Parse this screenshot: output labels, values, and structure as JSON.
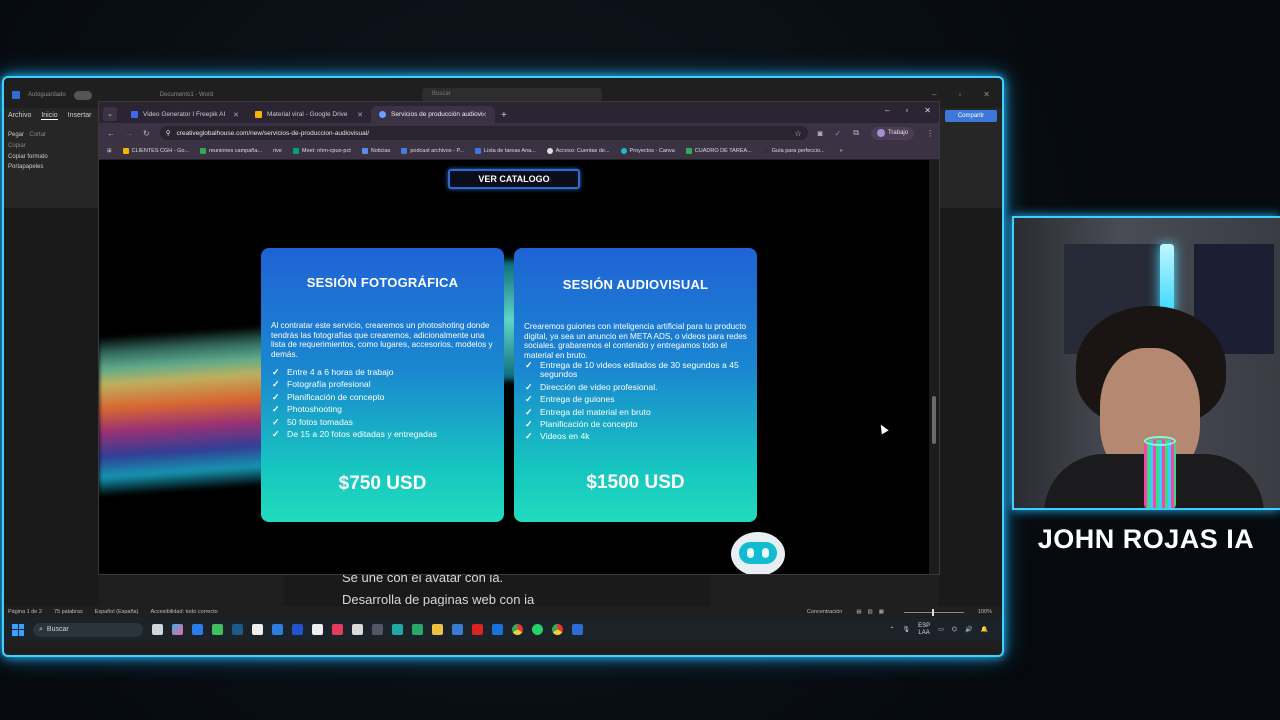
{
  "word": {
    "autosave_label": "Autoguardado",
    "doc_title": "Documento1 - Word",
    "search_placeholder": "Buscar",
    "tabs": [
      "Archivo",
      "Inicio",
      "Insertar"
    ],
    "clipboard": {
      "paste": "Pegar",
      "cut": "Cortar",
      "copy": "Copiar",
      "format_painter": "Copiar formato",
      "group": "Portapapeles"
    },
    "share_label": "Compartir",
    "doc_lines": [
      "Se une con el avatar con ia.",
      "Desarrolla de paginas web con ia"
    ],
    "status": {
      "page": "Página 1 de 2",
      "words": "75 palabras",
      "language": "Español (España)",
      "accessibility": "Accesibilidad: todo correcto",
      "focus": "Concentración",
      "zoom": "100%"
    }
  },
  "browser": {
    "tabs": [
      {
        "label": "Video Generator I Freepik AI",
        "fav": "#3b6cf0"
      },
      {
        "label": "Material viral - Google Drive",
        "fav": "#f2b400"
      },
      {
        "label": "Servicios de producción audiovi",
        "fav": "#6aa0ff"
      }
    ],
    "url": "creativeglobalhouse.com/new/servicios-de-produccion-audiovisual/",
    "profile": "Trabajo",
    "bookmarks": [
      {
        "label": "CLIENTES CGH - Go...",
        "color": "#f2b400"
      },
      {
        "label": "reuniones campaña...",
        "color": "#2faa55"
      },
      {
        "label": "rive",
        "color": "#222222"
      },
      {
        "label": "Meet: nhm-cpuo-pct",
        "color": "#00a37a"
      },
      {
        "label": "Noticias",
        "color": "#5a8cf0"
      },
      {
        "label": "podcast archivos - P...",
        "color": "#4a7ae0"
      },
      {
        "label": "Lista de tareas Ana...",
        "color": "#3a78e0"
      },
      {
        "label": "Acceso: Cuentas de...",
        "color": "#dddddd"
      },
      {
        "label": "Proyectos - Canva",
        "color": "#20b8d0"
      },
      {
        "label": "CUADRO DE TAREA...",
        "color": "#2faa55"
      },
      {
        "label": "Guía para perfeccio...",
        "color": "#333333"
      }
    ]
  },
  "page": {
    "catalog_button": "VER CATALOGO",
    "cards": [
      {
        "title": "SESIÓN FOTOGRÁFICA",
        "description": "Al contratar este servicio, crearemos un photoshoting donde tendrás las fotografías que crearemos, adicionalmente una lista de requerimientos, como lugares, accesorios, modelos y demás.",
        "features": [
          "Entre 4 a 6 horas de trabajo",
          "Fotografía profesional",
          "Planificación de concepto",
          "Photoshooting",
          "50 fotos tomadas",
          "De 15 a 20 fotos editadas y entregadas"
        ],
        "price": "$750 USD"
      },
      {
        "title": "SESIÓN AUDIOVISUAL",
        "description": "Crearemos guiones con inteligencia artificial para tu producto digital, ya sea un anuncio en META ADS, o videos para redes sociales. grabaremos el contenido y entregamos todo el material en bruto.",
        "features": [
          "Entrega de 10 videos editados de 30 segundos a 45 segundos",
          "Dirección de video profesional.",
          "Entrega de guiones",
          "Entrega del material en bruto",
          "Planificación de concepto",
          "Videos en 4k"
        ],
        "price": "$1500 USD"
      }
    ]
  },
  "taskbar": {
    "search": "Buscar",
    "lang_top": "ESP",
    "lang_bottom": "LAA"
  },
  "streamer": {
    "name": "JOHN ROJAS IA"
  }
}
